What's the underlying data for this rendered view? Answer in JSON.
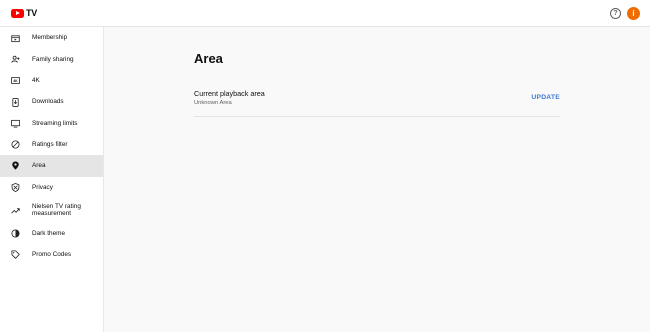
{
  "header": {
    "logo_text": "TV",
    "help_icon": "help-circle-icon",
    "avatar_initial": "i",
    "avatar_color": "#ef6c00",
    "brand_color": "#ff0000"
  },
  "sidebar": {
    "items": [
      {
        "label": "Membership",
        "icon": "membership-icon",
        "selected": false
      },
      {
        "label": "Family sharing",
        "icon": "family-sharing-icon",
        "selected": false
      },
      {
        "label": "4K",
        "icon": "4k-icon",
        "selected": false
      },
      {
        "label": "Downloads",
        "icon": "downloads-icon",
        "selected": false
      },
      {
        "label": "Streaming limits",
        "icon": "tv-icon",
        "selected": false
      },
      {
        "label": "Ratings filter",
        "icon": "block-icon",
        "selected": false
      },
      {
        "label": "Area",
        "icon": "location-pin-icon",
        "selected": true
      },
      {
        "label": "Privacy",
        "icon": "shield-icon",
        "selected": false
      },
      {
        "label": "Nielsen TV rating\nmeasurement",
        "icon": "trending-icon",
        "selected": false
      },
      {
        "label": "Dark theme",
        "icon": "dark-theme-icon",
        "selected": false
      },
      {
        "label": "Promo Codes",
        "icon": "tag-icon",
        "selected": false
      }
    ]
  },
  "main": {
    "title": "Area",
    "setting": {
      "title": "Current playback area",
      "value": "Unknown Area",
      "action_label": "UPDATE"
    }
  },
  "colors": {
    "accent": "#3c7bd6",
    "selected_bg": "#e5e5e5",
    "main_bg": "#f9f9f9"
  }
}
